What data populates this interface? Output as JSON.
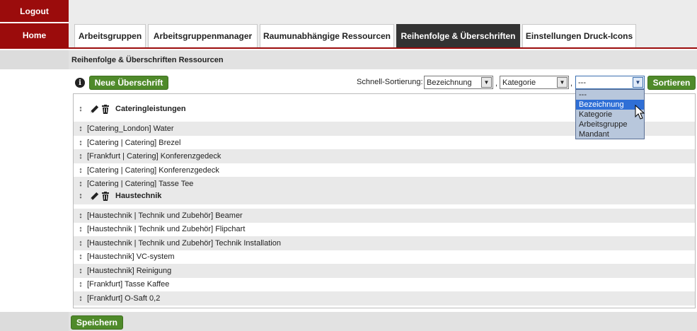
{
  "nav": {
    "logout": "Logout",
    "home": "Home"
  },
  "tabs": [
    {
      "label": "Arbeitsgruppen",
      "active": false
    },
    {
      "label": "Arbeitsgruppenmanager",
      "active": false
    },
    {
      "label": "Raumunabhängige Ressourcen",
      "active": false
    },
    {
      "label": "Reihenfolge & Überschriften",
      "active": true
    },
    {
      "label": "Einstellungen Druck-Icons",
      "active": false
    }
  ],
  "section_title": "Reihenfolge & Überschriften Ressourcen",
  "toolbar": {
    "info_glyph": "i",
    "new_heading_button": "Neue Überschrift",
    "sort_label": "Schnell-Sortierung:",
    "sort1": "Bezeichnung",
    "sort2": "Kategorie",
    "sort3": "---",
    "comma": ",",
    "sort_button": "Sortieren"
  },
  "dropdown_options": [
    {
      "label": "---",
      "selected": false
    },
    {
      "label": "Bezeichnung",
      "selected": true
    },
    {
      "label": "Kategorie",
      "selected": false
    },
    {
      "label": "Arbeitsgruppe",
      "selected": false
    },
    {
      "label": "Mandant",
      "selected": false
    }
  ],
  "rows": [
    {
      "type": "heading",
      "text": "Cateringleistungen"
    },
    {
      "type": "item",
      "text": "[Catering_London] Water"
    },
    {
      "type": "item",
      "text": "[Catering | Catering] Brezel"
    },
    {
      "type": "item",
      "text": "[Frankfurt | Catering] Konferenzgedeck"
    },
    {
      "type": "item",
      "text": "[Catering | Catering] Konferenzgedeck"
    },
    {
      "type": "item",
      "text": "[Catering | Catering] Tasse Tee"
    },
    {
      "type": "heading",
      "text": "Haustechnik"
    },
    {
      "type": "item",
      "text": "[Haustechnik | Technik und Zubehör] Beamer"
    },
    {
      "type": "item",
      "text": "[Haustechnik | Technik und Zubehör] Flipchart"
    },
    {
      "type": "item",
      "text": "[Haustechnik | Technik und Zubehör] Technik Installation"
    },
    {
      "type": "item",
      "text": "[Haustechnik] VC-system"
    },
    {
      "type": "item",
      "text": "[Haustechnik] Reinigung"
    },
    {
      "type": "item",
      "text": "[Frankfurt] Tasse Kaffee"
    },
    {
      "type": "item",
      "text": "[Frankfurt] O-Saft 0,2"
    }
  ],
  "save_button": "Speichern",
  "colors": {
    "accent": "#9b0c0c",
    "green": "#4f8a2a",
    "active_tab": "#333333",
    "selected_option": "#2f6fd6"
  }
}
